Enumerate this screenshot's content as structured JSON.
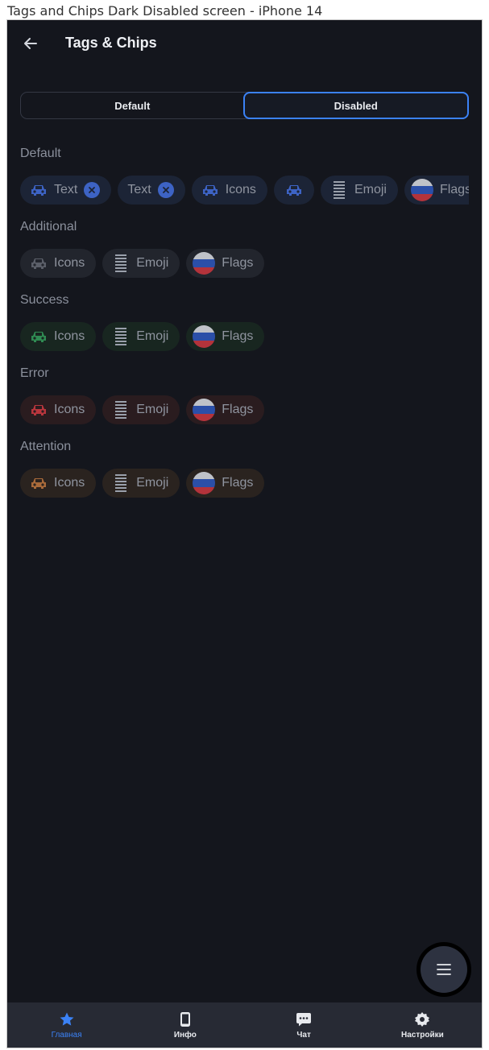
{
  "window": {
    "title": "Tags and Chips Dark Disabled screen - iPhone 14"
  },
  "header": {
    "back_icon": "arrow-left-icon",
    "title": "Tags & Chips"
  },
  "segmented": {
    "options": [
      "Default",
      "Disabled"
    ],
    "selected": "Disabled"
  },
  "colors": {
    "accent": "#3b82f6",
    "default_icon": "#3d63c4",
    "additional_icon": "#5b5f69",
    "success_icon": "#2f8a52",
    "error_icon": "#b8363d",
    "attention_icon": "#a86a3a"
  },
  "sections": {
    "default": {
      "label": "Default",
      "chips": [
        {
          "icon": "car-icon",
          "text": "Text",
          "close": "close-circle-icon"
        },
        {
          "text": "Text",
          "close": "close-circle-icon"
        },
        {
          "icon": "car-icon",
          "text": "Icons"
        },
        {
          "icon": "car-icon"
        },
        {
          "icon": "emoji-icon",
          "text": "Emoji"
        },
        {
          "icon": "flag-russia-icon",
          "text": "Flags"
        }
      ]
    },
    "additional": {
      "label": "Additional",
      "chips": [
        {
          "icon": "car-icon",
          "text": "Icons"
        },
        {
          "icon": "emoji-icon",
          "text": "Emoji"
        },
        {
          "icon": "flag-russia-icon",
          "text": "Flags"
        }
      ]
    },
    "success": {
      "label": "Success",
      "chips": [
        {
          "icon": "car-icon",
          "text": "Icons"
        },
        {
          "icon": "emoji-icon",
          "text": "Emoji"
        },
        {
          "icon": "flag-russia-icon",
          "text": "Flags"
        }
      ]
    },
    "error": {
      "label": "Error",
      "chips": [
        {
          "icon": "car-icon",
          "text": "Icons"
        },
        {
          "icon": "emoji-icon",
          "text": "Emoji"
        },
        {
          "icon": "flag-russia-icon",
          "text": "Flags"
        }
      ]
    },
    "attention": {
      "label": "Attention",
      "chips": [
        {
          "icon": "car-icon",
          "text": "Icons"
        },
        {
          "icon": "emoji-icon",
          "text": "Emoji"
        },
        {
          "icon": "flag-russia-icon",
          "text": "Flags"
        }
      ]
    }
  },
  "fab": {
    "icon": "menu-icon"
  },
  "bottom_nav": {
    "items": [
      {
        "label": "Главная",
        "icon": "star-icon",
        "active": true
      },
      {
        "label": "Инфо",
        "icon": "phone-icon"
      },
      {
        "label": "Чат",
        "icon": "chat-icon"
      },
      {
        "label": "Настройки",
        "icon": "gear-icon"
      }
    ]
  }
}
